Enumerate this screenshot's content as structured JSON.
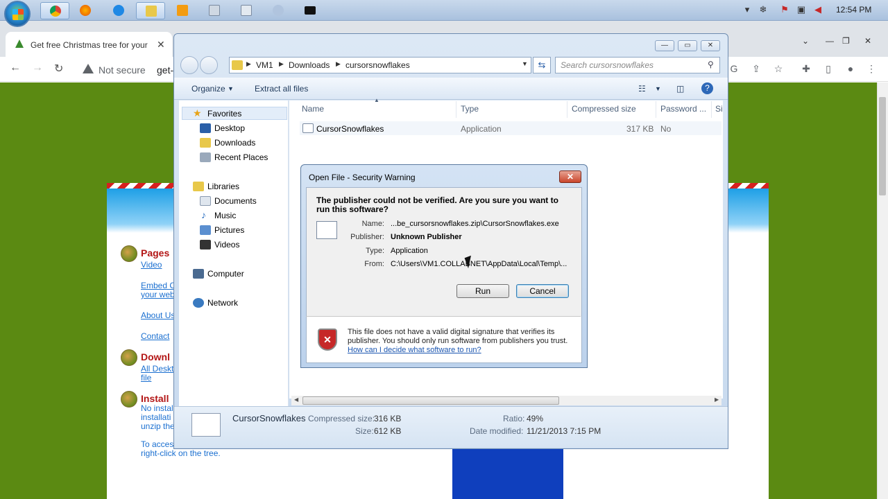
{
  "taskbar": {
    "clock": "12:54 PM",
    "apps": [
      "chrome-icon",
      "firefox-icon",
      "ie-icon",
      "explorer-icon",
      "media-icon",
      "document-icon",
      "calculator-icon",
      "network-icon",
      "cmd-icon"
    ]
  },
  "browser": {
    "tab_title": "Get free Christmas tree for your d",
    "tab_close": "✕",
    "not_secure": "Not secure",
    "url_fragment": "get-",
    "win_minimize": "—",
    "win_restore": "❐",
    "win_close": "✕"
  },
  "page": {
    "sections": [
      {
        "heading": "Pages",
        "links": [
          "Video",
          "Embed Cu",
          "your web",
          "About Us",
          "Contact"
        ]
      },
      {
        "heading": "Downl",
        "links": [
          "All Deskt",
          "file"
        ]
      },
      {
        "heading": "Install",
        "lines": [
          "No instal",
          "installati",
          "unzip the",
          "To acces",
          "right-click on the tree."
        ]
      }
    ]
  },
  "explorer": {
    "breadcrumb": [
      "VM1",
      "Downloads",
      "cursorsnowflakes"
    ],
    "search_placeholder": "Search cursorsnowflakes",
    "commands": {
      "organize": "Organize",
      "extract": "Extract all files"
    },
    "nav": {
      "favorites": "Favorites",
      "desktop": "Desktop",
      "downloads": "Downloads",
      "recent": "Recent Places",
      "libraries": "Libraries",
      "documents": "Documents",
      "music": "Music",
      "pictures": "Pictures",
      "videos": "Videos",
      "computer": "Computer",
      "network": "Network"
    },
    "columns": [
      "Name",
      "Type",
      "Compressed size",
      "Password ...",
      "Si"
    ],
    "file": {
      "name": "CursorSnowflakes",
      "type": "Application",
      "compressed": "317 KB",
      "password": "No"
    },
    "details": {
      "name": "CursorSnowflakes",
      "compressed_label": "Compressed size:",
      "compressed_value": "316 KB",
      "size_label": "Size:",
      "size_value": "612 KB",
      "ratio_label": "Ratio:",
      "ratio_value": "49%",
      "modified_label": "Date modified:",
      "modified_value": "11/21/2013 7:15 PM"
    }
  },
  "dialog": {
    "title": "Open File - Security Warning",
    "close": "✕",
    "question": "The publisher could not be verified.  Are you sure you want to run this software?",
    "name_label": "Name:",
    "name_value": "...be_cursorsnowflakes.zip\\CursorSnowflakes.exe",
    "publisher_label": "Publisher:",
    "publisher_value": "Unknown Publisher",
    "type_label": "Type:",
    "type_value": "Application",
    "from_label": "From:",
    "from_value": "C:\\Users\\VM1.COLLABNET\\AppData\\Local\\Temp\\...",
    "run": "Run",
    "cancel": "Cancel",
    "footer_text": "This file does not have a valid digital signature that verifies its publisher.  You should only run software from publishers you trust.",
    "footer_link": "How can I decide what software to run?"
  }
}
